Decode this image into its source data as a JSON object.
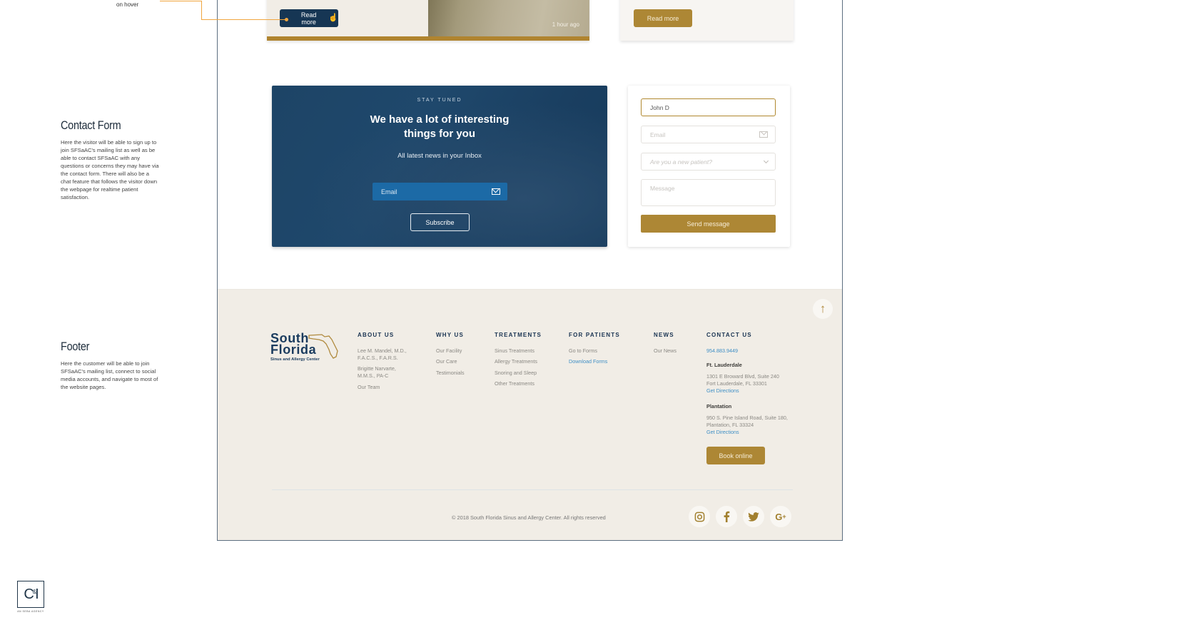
{
  "annotations": {
    "hover_note": "on hover",
    "contact_form": {
      "title": "Contact Form",
      "text": "Here the visitor will be able to sign up to join SFSaAC's mailing list as well as be able to contact SFSaAC with any questions or concerns they may have via the contact form. There will also be a chat feature that follows the visitor down the webpage for realtime patient satisfaction."
    },
    "footer": {
      "title": "Footer",
      "text": "Here the customer will be able to join SFSaAC's mailing list, connect to social media accounts, and navigate to most of the website pages."
    }
  },
  "news_cards": {
    "left": {
      "read_more": "Read more",
      "time_ago": "1 hour ago"
    },
    "right": {
      "read_more": "Read more"
    }
  },
  "newsletter": {
    "kicker": "STAY TUNED",
    "title": "We have a lot of interesting things for you",
    "subtitle": "All latest news in your Inbox",
    "email_placeholder": "Email",
    "subscribe_label": "Subscribe"
  },
  "contact_form": {
    "name_value": "John D",
    "email_placeholder": "Email",
    "patient_select_placeholder": "Are you a new patient?",
    "message_placeholder": "Message",
    "send_label": "Send message"
  },
  "footer": {
    "logo": {
      "line1": "South",
      "line2": "Florida",
      "tagline": "Sinus and Allergy Center"
    },
    "columns": [
      {
        "heading": "ABOUT US",
        "links": [
          "Lee M. Mandel, M.D., F.A.C.S., F.A.R.S.",
          "Brigitte Narvarte, M.M.S., PA-C",
          "Our Team"
        ]
      },
      {
        "heading": "WHY US",
        "links": [
          "Our Facility",
          "Our Care",
          "Testimonials"
        ]
      },
      {
        "heading": "TREATMENTS",
        "links": [
          "Sinus Treatments",
          "Allergy Treatments",
          "Snoring and Sleep",
          "Other Treatments"
        ]
      },
      {
        "heading": "FOR PATIENTS",
        "links": [
          "Go to Forms",
          "Download Forms"
        ]
      },
      {
        "heading": "NEWS",
        "links": [
          "Our News"
        ]
      }
    ],
    "contact": {
      "heading": "CONTACT US",
      "phone": "954.883.9449",
      "locations": [
        {
          "name": "Ft. Lauderdale",
          "address1": "1301 E Broward Blvd, Suite 240",
          "address2": "Fort Lauderdale, FL 33301",
          "directions": "Get Directions"
        },
        {
          "name": "Plantation",
          "address1": "950 S. Pine Island Road, Suite 180,",
          "address2": "Plantation, FL 33324",
          "directions": "Get Directions"
        }
      ],
      "book_label": "Book online"
    },
    "copyright": "© 2018 South Florida Sinus and Allergy Center. All rights reserved",
    "socials": [
      "instagram-icon",
      "facebook-icon",
      "twitter-icon",
      "google-plus-icon"
    ]
  },
  "agency": {
    "mark": "C",
    "amp": "&",
    "mark2": "I",
    "caption": "AN SEBA AGENCY"
  },
  "colors": {
    "navy": "#163654",
    "gold": "#ad8735",
    "footer_bg": "#f1ede6",
    "link_blue": "#3f8fc5",
    "connector": "#f0a640"
  }
}
